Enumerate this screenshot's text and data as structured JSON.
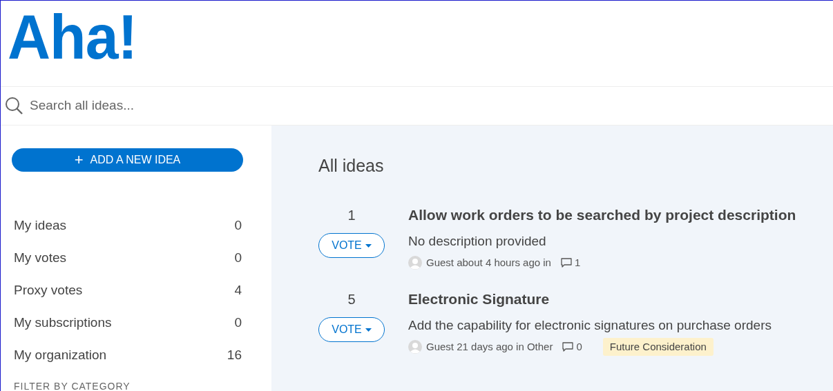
{
  "logo": "Aha!",
  "search": {
    "placeholder": "Search all ideas..."
  },
  "add_button": {
    "icon": "+",
    "label": "ADD A NEW IDEA"
  },
  "sidebar": {
    "items": [
      {
        "label": "My ideas",
        "count": "0"
      },
      {
        "label": "My votes",
        "count": "0"
      },
      {
        "label": "Proxy votes",
        "count": "4"
      },
      {
        "label": "My subscriptions",
        "count": "0"
      },
      {
        "label": "My organization",
        "count": "16"
      }
    ],
    "section_heading": "FILTER BY CATEGORY"
  },
  "main": {
    "heading": "All ideas",
    "ideas": [
      {
        "votes": "1",
        "vote_label": "VOTE",
        "title": "Allow work orders to be searched by project description",
        "description": "No description provided",
        "meta": "Guest about 4 hours ago in",
        "comments": "1"
      },
      {
        "votes": "5",
        "vote_label": "VOTE",
        "title": "Electronic Signature",
        "description": "Add the capability for electronic signatures on purchase orders",
        "meta": "Guest 21 days ago in Other",
        "comments": "0",
        "status": "Future Consideration"
      }
    ]
  }
}
